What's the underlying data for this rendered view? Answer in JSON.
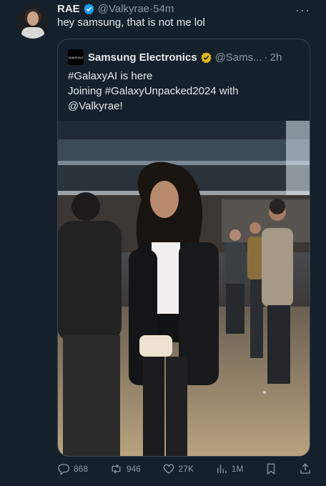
{
  "tweet": {
    "author_name": "RAE",
    "handle": "@Valkyrae",
    "separator": "·",
    "time": "54m",
    "more": "···",
    "text": "hey samsung, that is not me lol",
    "avatar_icon": "user-avatar"
  },
  "quoted": {
    "logo_text": "SAMSUNG",
    "author_name": "Samsung Electronics",
    "handle": "@Sams...",
    "separator": "·",
    "time": "2h",
    "lines": [
      "#GalaxyAI is here",
      "Joining #GalaxyUnpacked2024 with",
      "@Valkyrae!"
    ],
    "verified_color": "#e2b719"
  },
  "actions": {
    "replies": "868",
    "retweets": "946",
    "likes": "27K",
    "views": "1M"
  },
  "colors": {
    "background": "#15202b",
    "text": "#e7e9ea",
    "muted": "#8b98a5",
    "verified_blue": "#1d9bf0",
    "border": "#38444d"
  }
}
